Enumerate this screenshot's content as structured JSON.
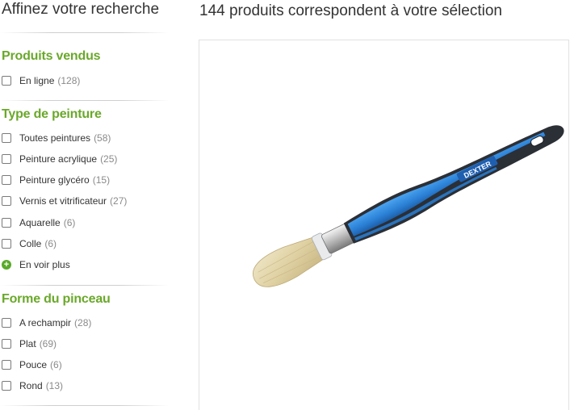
{
  "sidebar": {
    "title": "Affinez votre recherche",
    "sections": [
      {
        "title": "Produits vendus",
        "items": [
          {
            "label": "En ligne",
            "count": "(128)"
          }
        ]
      },
      {
        "title": "Type de peinture",
        "items": [
          {
            "label": "Toutes peintures",
            "count": "(58)"
          },
          {
            "label": "Peinture acrylique",
            "count": "(25)"
          },
          {
            "label": "Peinture glycéro",
            "count": "(15)"
          },
          {
            "label": "Vernis et vitrificateur",
            "count": "(27)"
          },
          {
            "label": "Aquarelle",
            "count": "(6)"
          },
          {
            "label": "Colle",
            "count": "(6)"
          }
        ],
        "more_label": "En voir plus"
      },
      {
        "title": "Forme du pinceau",
        "items": [
          {
            "label": "A rechampir",
            "count": "(28)"
          },
          {
            "label": "Plat",
            "count": "(69)"
          },
          {
            "label": "Pouce",
            "count": "(6)"
          },
          {
            "label": "Rond",
            "count": "(13)"
          }
        ]
      }
    ]
  },
  "main": {
    "results_title": "144 produits correspondent à votre sélection",
    "product": {
      "brand_text": "DEXTER"
    }
  },
  "colors": {
    "accent_green": "#6aa82a",
    "handle_blue": "#2a7fd4",
    "handle_dark": "#2b2f36"
  }
}
